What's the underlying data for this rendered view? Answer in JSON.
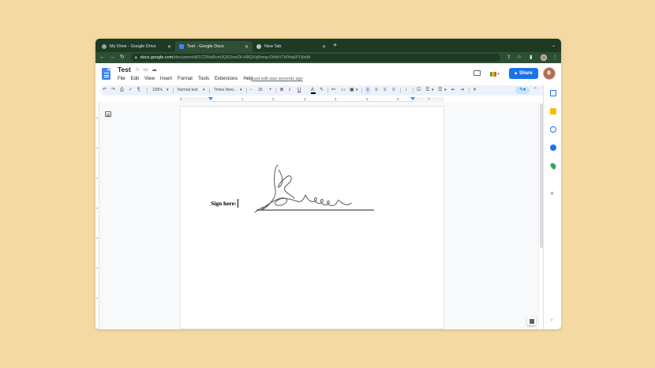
{
  "browser": {
    "tabs": [
      {
        "title": "My Drive - Google Drive",
        "active": false,
        "icon": "drive-icon",
        "icon_color": "#9aa0a6"
      },
      {
        "title": "Test - Google Docs",
        "active": true,
        "icon": "docs-icon",
        "icon_color": "#4285f4"
      },
      {
        "title": "New Tab",
        "active": false,
        "icon": "chrome-icon",
        "icon_color": "#bdc1c6"
      }
    ],
    "tab_close_glyph": "✕",
    "new_tab_glyph": "+",
    "tab_menu_glyph": "⌄",
    "url_domain": "docs.google.com",
    "url_path": "/document/d/1CDNoBcm3Q63osrDt-H8QXq5mop-DihkV7rFfdatXYj/edit",
    "nav_icons": [
      "back-icon",
      "forward-icon",
      "reload-icon"
    ],
    "theme_color": "#1e3a25"
  },
  "docs": {
    "title": "Test",
    "title_icons": [
      "star-icon",
      "move-to-folder-icon",
      "cloud-status-icon"
    ],
    "menu": [
      "File",
      "Edit",
      "View",
      "Insert",
      "Format",
      "Tools",
      "Extensions",
      "Help"
    ],
    "last_edit": "Last edit was seconds ago",
    "share_label": "Share",
    "share_color": "#1a73e8"
  },
  "format_toolbar": {
    "zoom": "100%",
    "style": "Normal text",
    "font": "Times New...",
    "font_size": "15",
    "bold": "B",
    "italic": "I",
    "underline": "U",
    "text_color": "A",
    "minus": "−",
    "plus": "+"
  },
  "ruler": {
    "numbers": [
      "1",
      "1",
      "2",
      "3",
      "4",
      "5",
      "6",
      "7"
    ]
  },
  "document": {
    "sign_label": "Sign here:"
  },
  "side_panel": {
    "icons": [
      "calendar-icon",
      "keep-icon",
      "tasks-icon",
      "contacts-icon",
      "maps-icon"
    ],
    "add_glyph": "+",
    "collapse_glyph": "›"
  }
}
